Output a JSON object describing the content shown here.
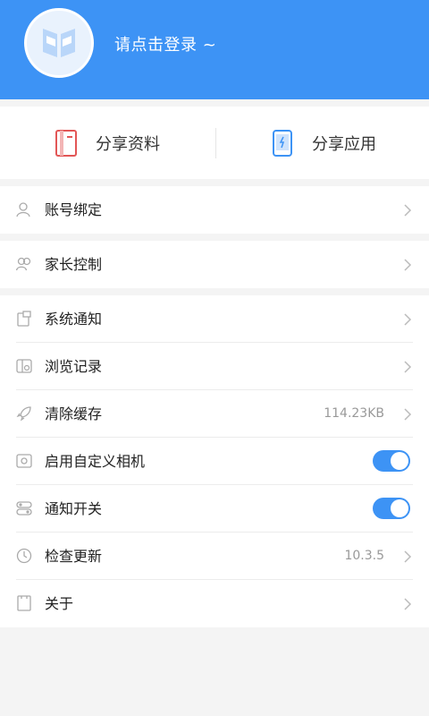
{
  "header": {
    "login_prompt": "请点击登录 ~",
    "avatar_icon": "book-logo-icon",
    "bg_color": "#3d93f5"
  },
  "share": {
    "left": {
      "label": "分享资料",
      "icon": "book-icon",
      "color": "#e25656"
    },
    "right": {
      "label": "分享应用",
      "icon": "phone-icon",
      "color": "#3d93f5"
    }
  },
  "groups": {
    "account": {
      "label": "账号绑定",
      "icon": "user-icon"
    },
    "parent": {
      "label": "家长控制",
      "icon": "users-icon"
    },
    "settings": [
      {
        "label": "系统通知",
        "icon": "notification-icon"
      },
      {
        "label": "浏览记录",
        "icon": "history-icon"
      },
      {
        "label": "清除缓存",
        "icon": "rocket-icon",
        "value": "114.23KB"
      },
      {
        "label": "启用自定义相机",
        "icon": "camera-icon",
        "toggle_on": true
      },
      {
        "label": "通知开关",
        "icon": "switch-icon",
        "toggle_on": true
      },
      {
        "label": "检查更新",
        "icon": "update-icon",
        "value": "10.3.5"
      },
      {
        "label": "关于",
        "icon": "info-icon"
      }
    ]
  }
}
